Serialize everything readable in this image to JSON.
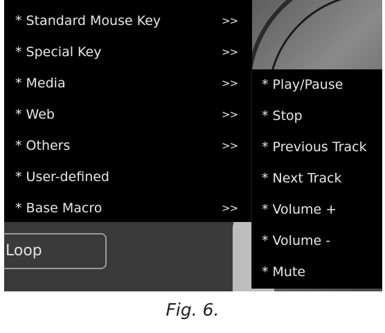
{
  "main_menu": {
    "items": [
      {
        "label": "* Standard Mouse Key",
        "arrow": ">>"
      },
      {
        "label": "* Special Key",
        "arrow": ">>"
      },
      {
        "label": "* Media",
        "arrow": ">>"
      },
      {
        "label": "* Web",
        "arrow": ">>"
      },
      {
        "label": "* Others",
        "arrow": ">>"
      },
      {
        "label": "* User-defined",
        "arrow": ""
      },
      {
        "label": "* Base Macro",
        "arrow": ">>"
      }
    ]
  },
  "sub_menu": {
    "items": [
      {
        "label": "* Play/Pause"
      },
      {
        "label": "* Stop"
      },
      {
        "label": "* Previous Track"
      },
      {
        "label": "* Next Track"
      },
      {
        "label": "* Volume +"
      },
      {
        "label": "* Volume -"
      },
      {
        "label": "* Mute"
      }
    ]
  },
  "loop_button": {
    "label": "Loop"
  },
  "caption": "Fig. 6."
}
